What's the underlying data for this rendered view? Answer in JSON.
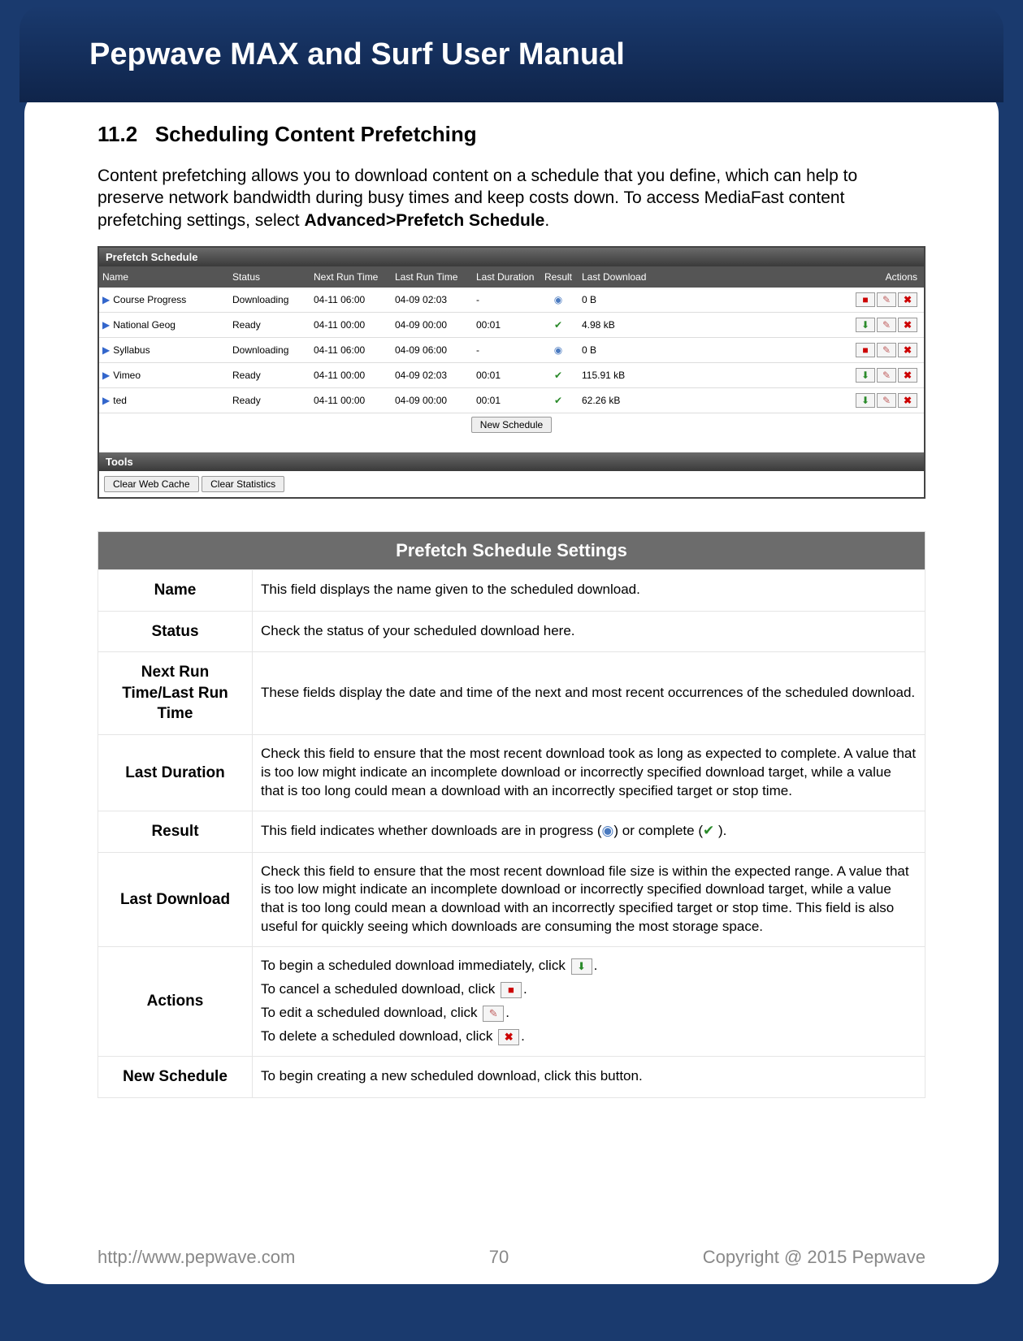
{
  "doc_title": "Pepwave MAX and Surf User Manual",
  "section_number": "11.2",
  "section_title": "Scheduling Content Prefetching",
  "intro_plain": "Content prefetching allows you to download content on a schedule that you define, which can help to preserve network bandwidth during busy times and keep costs down. To access MediaFast content prefetching settings, select ",
  "intro_bold": "Advanced>Prefetch Schedule",
  "intro_tail": ".",
  "mock": {
    "title": "Prefetch Schedule",
    "headers": {
      "name": "Name",
      "status": "Status",
      "next": "Next Run Time",
      "last": "Last Run Time",
      "dur": "Last Duration",
      "result": "Result",
      "dl": "Last Download",
      "actions": "Actions"
    },
    "rows": [
      {
        "name": "Course Progress",
        "status": "Downloading",
        "next": "04-11 06:00",
        "last": "04-09 02:03",
        "dur": "-",
        "result": "spin",
        "dl": "0 B",
        "action1": "stop"
      },
      {
        "name": "National Geog",
        "status": "Ready",
        "next": "04-11 00:00",
        "last": "04-09 00:00",
        "dur": "00:01",
        "result": "check",
        "dl": "4.98 kB",
        "action1": "dl"
      },
      {
        "name": "Syllabus",
        "status": "Downloading",
        "next": "04-11 06:00",
        "last": "04-09 06:00",
        "dur": "-",
        "result": "spin",
        "dl": "0 B",
        "action1": "stop"
      },
      {
        "name": "Vimeo",
        "status": "Ready",
        "next": "04-11 00:00",
        "last": "04-09 02:03",
        "dur": "00:01",
        "result": "check",
        "dl": "115.91 kB",
        "action1": "dl"
      },
      {
        "name": "ted",
        "status": "Ready",
        "next": "04-11 00:00",
        "last": "04-09 00:00",
        "dur": "00:01",
        "result": "check",
        "dl": "62.26 kB",
        "action1": "dl"
      }
    ],
    "new_schedule_btn": "New Schedule",
    "tools_title": "Tools",
    "clear_cache_btn": "Clear Web Cache",
    "clear_stats_btn": "Clear Statistics"
  },
  "settings": {
    "header": "Prefetch Schedule Settings",
    "rows": [
      {
        "label": "Name",
        "desc": "This field displays the name given to the scheduled download."
      },
      {
        "label": "Status",
        "desc": "Check the status of your scheduled download here."
      },
      {
        "label": "Next Run Time/Last Run Time",
        "desc": "These fields display the date and time of the next and most recent occurrences of the scheduled download."
      },
      {
        "label": "Last Duration",
        "desc": "Check this field to ensure that the most recent download took as long as expected to complete. A value that is too low might indicate an incomplete download or incorrectly specified download target, while a value that is too long could mean a download with an incorrectly specified target or stop time."
      },
      {
        "label": "Result",
        "desc_pre": "This field indicates whether downloads are in progress (",
        "desc_mid": ") or complete (",
        "desc_post": " )."
      },
      {
        "label": "Last Download",
        "desc": "Check this field to ensure that the most recent download file size is within the expected range. A value that is too low might indicate an incomplete download or incorrectly specified download target, while a value that is too long could mean a download with an incorrectly specified target or stop time. This field is also useful for quickly seeing which downloads are consuming the most storage space."
      },
      {
        "label": "Actions",
        "a1": "To begin a scheduled download immediately, click ",
        "a2": "To cancel a scheduled download, click ",
        "a3": "To edit a scheduled download, click ",
        "a4": "To delete a scheduled download, click "
      },
      {
        "label": "New Schedule",
        "desc": "To begin creating a new scheduled download, click this button."
      }
    ]
  },
  "footer": {
    "url": "http://www.pepwave.com",
    "page": "70",
    "copyright": "Copyright @ 2015 Pepwave"
  }
}
